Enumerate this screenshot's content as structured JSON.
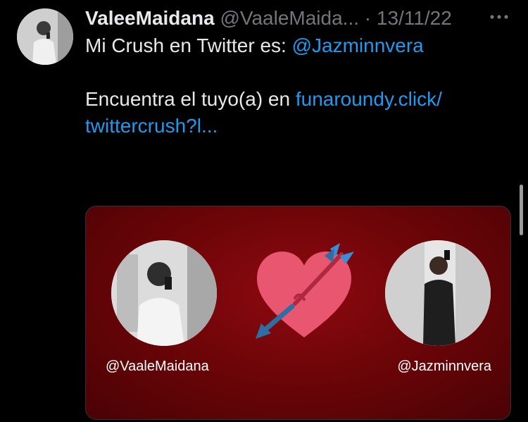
{
  "tweet": {
    "author_name": "ValeeMaidana",
    "author_handle": "@VaaleMaida...",
    "separator": "·",
    "date": "13/11/22",
    "text_prefix": "Mi Crush en Twitter es: ",
    "mention": "@Jazminnvera",
    "text2_prefix": "Encuentra el tuyo(a) en ",
    "link_line1": "funaroundy.click/",
    "link_line2": "twittercrush?l..."
  },
  "card": {
    "left_username": "@VaaleMaidana",
    "right_username": "@Jazminnvera",
    "heart_icon": "heart-with-arrow-icon",
    "background": "#7a060b"
  },
  "colors": {
    "link": "#1d9bf0",
    "muted": "#71767b",
    "text": "#e7e9ea"
  }
}
